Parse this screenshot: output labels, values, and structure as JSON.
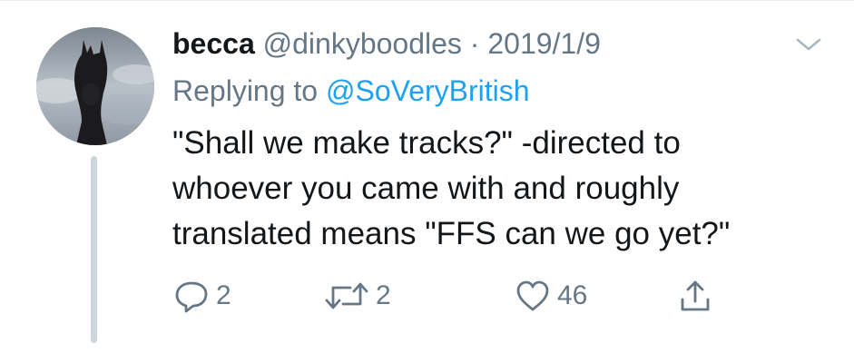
{
  "tweet": {
    "display_name": "becca",
    "handle": "@dinkyboodles",
    "separator": "·",
    "date": "2019/1/9",
    "replying_to_label": "Replying to",
    "replying_to_handle": "@SoVeryBritish",
    "text_lines": [
      "\"Shall we make tracks?\" -directed to",
      "whoever you came with and roughly",
      "translated means \"FFS can we go yet?\""
    ]
  },
  "actions": {
    "reply_count": "2",
    "retweet_count": "2",
    "like_count": "46"
  },
  "icons": {
    "menu": "chevron-down-icon",
    "reply": "reply-icon",
    "retweet": "retweet-icon",
    "like": "heart-icon",
    "share": "share-icon"
  },
  "colors": {
    "text": "#14171a",
    "secondary": "#657786",
    "link": "#1da1f2",
    "thread_line": "#ccd6dd"
  }
}
